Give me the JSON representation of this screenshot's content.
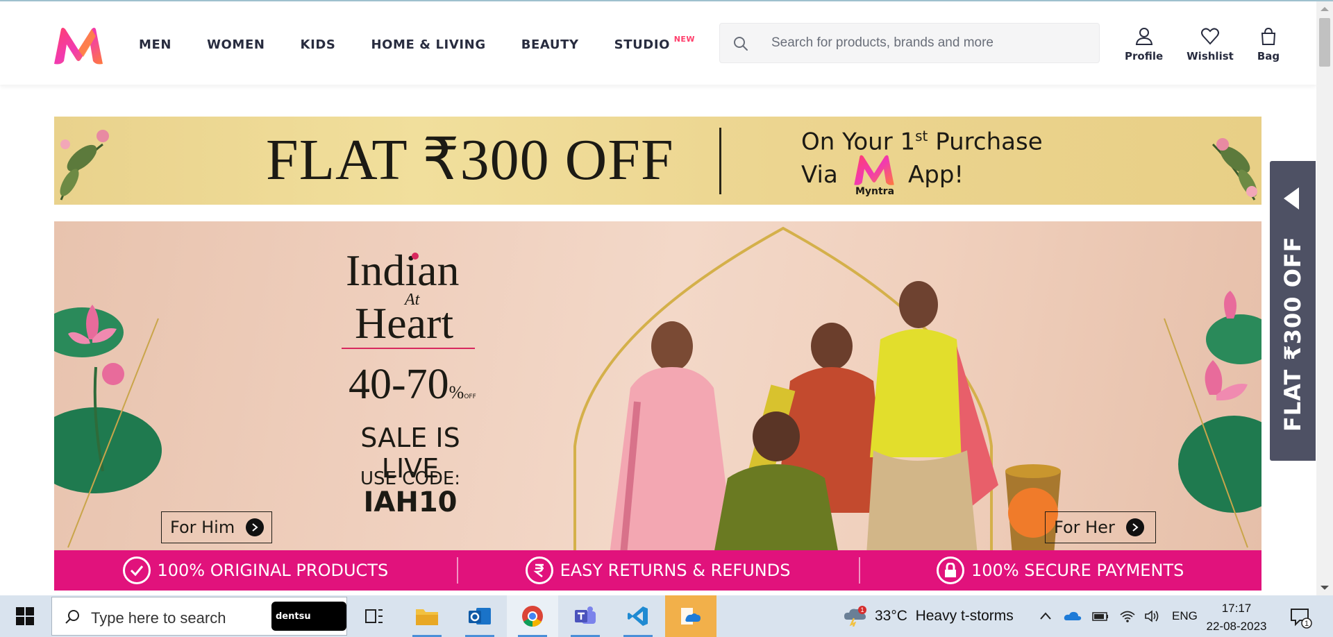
{
  "header": {
    "nav": [
      {
        "label": "MEN"
      },
      {
        "label": "WOMEN"
      },
      {
        "label": "KIDS"
      },
      {
        "label": "HOME & LIVING"
      },
      {
        "label": "BEAUTY"
      },
      {
        "label": "STUDIO",
        "badge": "NEW"
      }
    ],
    "search": {
      "placeholder": "Search for products, brands and more"
    },
    "actions": {
      "profile": "Profile",
      "wishlist": "Wishlist",
      "bag": "Bag"
    }
  },
  "offer_strip": {
    "main_text": "FLAT ₹300 OFF",
    "line1_prefix": "On Your 1",
    "line1_sup": "st",
    "line1_suffix": " Purchase",
    "via": "Via",
    "app": "App!",
    "logo_text": "Myntra"
  },
  "hero": {
    "title_1": "Indian",
    "title_2": "At",
    "title_3": "Heart",
    "discount": "40-70",
    "discount_unit": "%",
    "discount_off": "OFF",
    "sale": "SALE IS LIVE",
    "use_code": "USE CODE:",
    "code": "IAH10",
    "cta_him": "For Him",
    "cta_her": "For Her"
  },
  "trust_bar": [
    {
      "label": "100% ORIGINAL PRODUCTS",
      "icon": "check-circle-icon"
    },
    {
      "label": "EASY RETURNS & REFUNDS",
      "icon": "rupee-circle-icon"
    },
    {
      "label": "100% SECURE PAYMENTS",
      "icon": "lock-circle-icon"
    }
  ],
  "side_tab": {
    "label": "FLAT ₹300 OFF"
  },
  "taskbar": {
    "search_text": "Type here to search",
    "search_badge": "dentsu",
    "weather": "33°C  Heavy t-storms",
    "weather_alert": "1",
    "language": "ENG",
    "time": "17:17",
    "date": "22-08-2023",
    "notifications": "1"
  },
  "colors": {
    "brand_pink": "#ff3f6c",
    "trust_bar": "#e1127c",
    "side_tab": "#4e5164",
    "nav_text": "#282c3f"
  }
}
